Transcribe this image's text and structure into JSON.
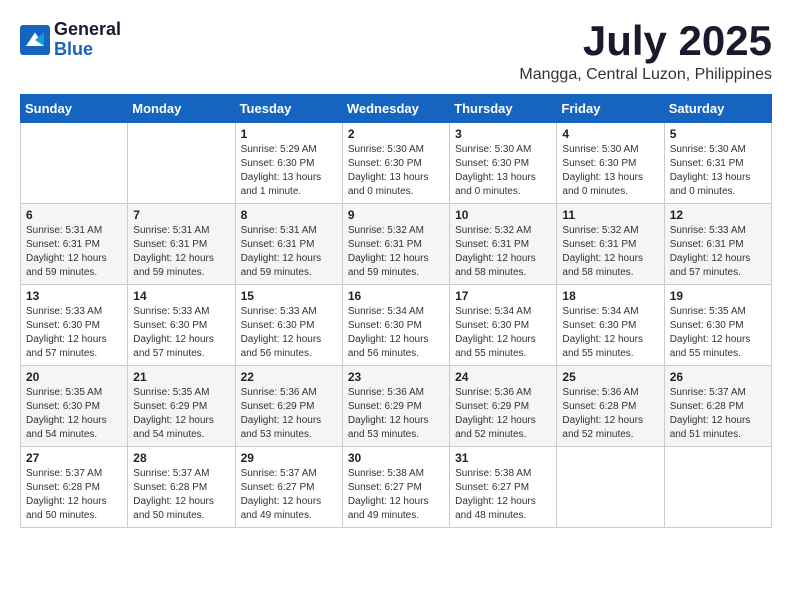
{
  "logo": {
    "general": "General",
    "blue": "Blue"
  },
  "title": "July 2025",
  "location": "Mangga, Central Luzon, Philippines",
  "weekdays": [
    "Sunday",
    "Monday",
    "Tuesday",
    "Wednesday",
    "Thursday",
    "Friday",
    "Saturday"
  ],
  "weeks": [
    [
      {
        "day": "",
        "content": ""
      },
      {
        "day": "",
        "content": ""
      },
      {
        "day": "1",
        "content": "Sunrise: 5:29 AM\nSunset: 6:30 PM\nDaylight: 13 hours and 1 minute."
      },
      {
        "day": "2",
        "content": "Sunrise: 5:30 AM\nSunset: 6:30 PM\nDaylight: 13 hours and 0 minutes."
      },
      {
        "day": "3",
        "content": "Sunrise: 5:30 AM\nSunset: 6:30 PM\nDaylight: 13 hours and 0 minutes."
      },
      {
        "day": "4",
        "content": "Sunrise: 5:30 AM\nSunset: 6:30 PM\nDaylight: 13 hours and 0 minutes."
      },
      {
        "day": "5",
        "content": "Sunrise: 5:30 AM\nSunset: 6:31 PM\nDaylight: 13 hours and 0 minutes."
      }
    ],
    [
      {
        "day": "6",
        "content": "Sunrise: 5:31 AM\nSunset: 6:31 PM\nDaylight: 12 hours and 59 minutes."
      },
      {
        "day": "7",
        "content": "Sunrise: 5:31 AM\nSunset: 6:31 PM\nDaylight: 12 hours and 59 minutes."
      },
      {
        "day": "8",
        "content": "Sunrise: 5:31 AM\nSunset: 6:31 PM\nDaylight: 12 hours and 59 minutes."
      },
      {
        "day": "9",
        "content": "Sunrise: 5:32 AM\nSunset: 6:31 PM\nDaylight: 12 hours and 59 minutes."
      },
      {
        "day": "10",
        "content": "Sunrise: 5:32 AM\nSunset: 6:31 PM\nDaylight: 12 hours and 58 minutes."
      },
      {
        "day": "11",
        "content": "Sunrise: 5:32 AM\nSunset: 6:31 PM\nDaylight: 12 hours and 58 minutes."
      },
      {
        "day": "12",
        "content": "Sunrise: 5:33 AM\nSunset: 6:31 PM\nDaylight: 12 hours and 57 minutes."
      }
    ],
    [
      {
        "day": "13",
        "content": "Sunrise: 5:33 AM\nSunset: 6:30 PM\nDaylight: 12 hours and 57 minutes."
      },
      {
        "day": "14",
        "content": "Sunrise: 5:33 AM\nSunset: 6:30 PM\nDaylight: 12 hours and 57 minutes."
      },
      {
        "day": "15",
        "content": "Sunrise: 5:33 AM\nSunset: 6:30 PM\nDaylight: 12 hours and 56 minutes."
      },
      {
        "day": "16",
        "content": "Sunrise: 5:34 AM\nSunset: 6:30 PM\nDaylight: 12 hours and 56 minutes."
      },
      {
        "day": "17",
        "content": "Sunrise: 5:34 AM\nSunset: 6:30 PM\nDaylight: 12 hours and 55 minutes."
      },
      {
        "day": "18",
        "content": "Sunrise: 5:34 AM\nSunset: 6:30 PM\nDaylight: 12 hours and 55 minutes."
      },
      {
        "day": "19",
        "content": "Sunrise: 5:35 AM\nSunset: 6:30 PM\nDaylight: 12 hours and 55 minutes."
      }
    ],
    [
      {
        "day": "20",
        "content": "Sunrise: 5:35 AM\nSunset: 6:30 PM\nDaylight: 12 hours and 54 minutes."
      },
      {
        "day": "21",
        "content": "Sunrise: 5:35 AM\nSunset: 6:29 PM\nDaylight: 12 hours and 54 minutes."
      },
      {
        "day": "22",
        "content": "Sunrise: 5:36 AM\nSunset: 6:29 PM\nDaylight: 12 hours and 53 minutes."
      },
      {
        "day": "23",
        "content": "Sunrise: 5:36 AM\nSunset: 6:29 PM\nDaylight: 12 hours and 53 minutes."
      },
      {
        "day": "24",
        "content": "Sunrise: 5:36 AM\nSunset: 6:29 PM\nDaylight: 12 hours and 52 minutes."
      },
      {
        "day": "25",
        "content": "Sunrise: 5:36 AM\nSunset: 6:28 PM\nDaylight: 12 hours and 52 minutes."
      },
      {
        "day": "26",
        "content": "Sunrise: 5:37 AM\nSunset: 6:28 PM\nDaylight: 12 hours and 51 minutes."
      }
    ],
    [
      {
        "day": "27",
        "content": "Sunrise: 5:37 AM\nSunset: 6:28 PM\nDaylight: 12 hours and 50 minutes."
      },
      {
        "day": "28",
        "content": "Sunrise: 5:37 AM\nSunset: 6:28 PM\nDaylight: 12 hours and 50 minutes."
      },
      {
        "day": "29",
        "content": "Sunrise: 5:37 AM\nSunset: 6:27 PM\nDaylight: 12 hours and 49 minutes."
      },
      {
        "day": "30",
        "content": "Sunrise: 5:38 AM\nSunset: 6:27 PM\nDaylight: 12 hours and 49 minutes."
      },
      {
        "day": "31",
        "content": "Sunrise: 5:38 AM\nSunset: 6:27 PM\nDaylight: 12 hours and 48 minutes."
      },
      {
        "day": "",
        "content": ""
      },
      {
        "day": "",
        "content": ""
      }
    ]
  ]
}
